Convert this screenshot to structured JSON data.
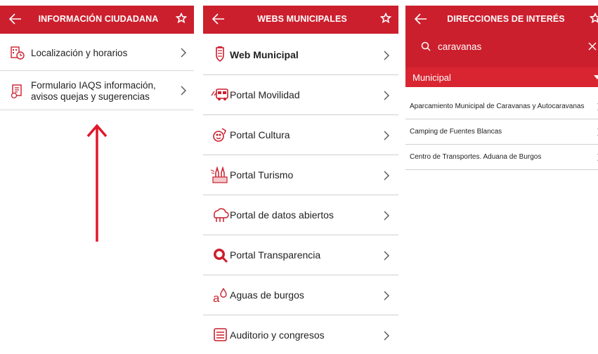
{
  "colors": {
    "brand_red": "#cc1f2d",
    "filter_red": "#d92531",
    "annotation_red": "#e0182a"
  },
  "panel_informacion": {
    "title": "INFORMACIÓN CIUDADANA",
    "items": [
      {
        "label": "Localización y horarios",
        "icon": "clock-building-icon"
      },
      {
        "label": "Formulario IAQS información, avisos quejas y sugerencias",
        "icon": "form-icon"
      }
    ]
  },
  "panel_webs": {
    "title": "WEBS MUNICIPALES",
    "items": [
      {
        "label": "Web Municipal",
        "icon": "coat-of-arms-icon"
      },
      {
        "label": "Portal Movilidad",
        "icon": "bus-icon"
      },
      {
        "label": "Portal Cultura",
        "icon": "culture-icon"
      },
      {
        "label": "Portal Turismo",
        "icon": "cathedral-icon"
      },
      {
        "label": "Portal de datos abiertos",
        "icon": "cloud-data-icon"
      },
      {
        "label": "Portal Transparencia",
        "icon": "magnifier-icon"
      },
      {
        "label": "Aguas de burgos",
        "icon": "water-drop-icon"
      },
      {
        "label": "Auditorio y congresos",
        "icon": "document-icon"
      }
    ]
  },
  "panel_direcciones": {
    "title": "DIRECCIONES DE INTERÉS",
    "search": {
      "value": "caravanas"
    },
    "filter": {
      "selected": "Municipal"
    },
    "results": [
      {
        "label": "Aparcamiento Municipal de Caravanas y Autocaravanas"
      },
      {
        "label": "Camping de Fuentes Blancas"
      },
      {
        "label": "Centro de Transportes. Aduana de Burgos"
      }
    ]
  }
}
